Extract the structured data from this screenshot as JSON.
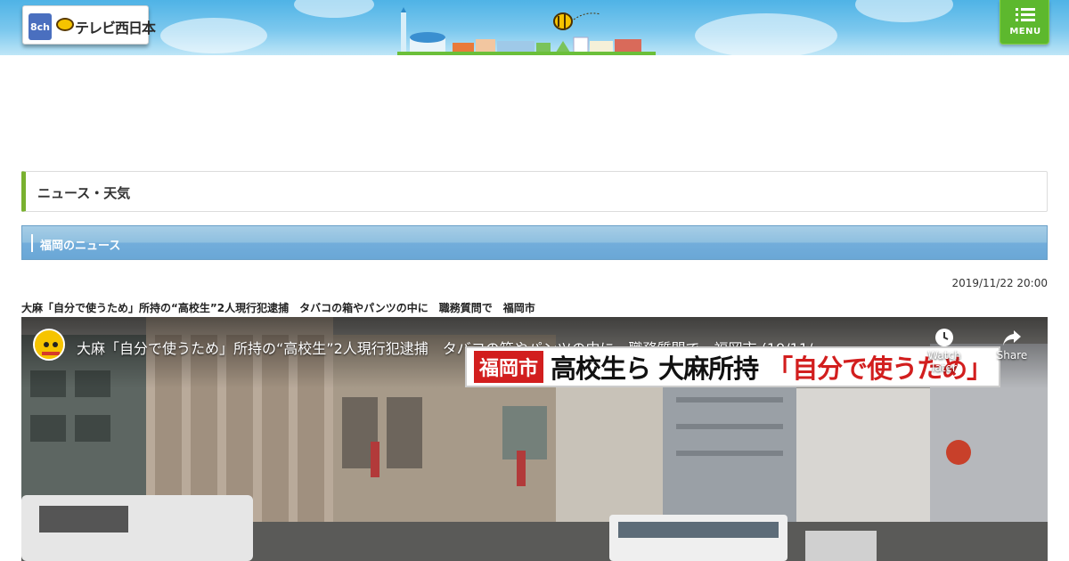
{
  "header": {
    "channel_badge": "8ch",
    "logo_text": "テレビ西日本",
    "menu_label": "MENU",
    "menu_icon": "list-menu-icon"
  },
  "section": {
    "title": "ニュース・天気"
  },
  "region": {
    "title": "福岡のニュース"
  },
  "article": {
    "date": "2019/11/22 20:00",
    "headline": "大麻「自分で使うため」所持の“高校生”2人現行犯逮捕　タバコの箱やパンツの中に　職務質問で　福岡市"
  },
  "video": {
    "title": "大麻「自分で使うため」所持の“高校生”2人現行犯逮捕　タバコの箱やパンツの中に　職務質問で　福岡市 (19/11/...",
    "watch_later_label": "Watch later",
    "share_label": "Share",
    "caption_city": "福岡市",
    "caption_main": "高校生ら 大麻所持",
    "caption_quote": "「自分で使うため」",
    "channel_icon": "channel-avatar-icon"
  },
  "colors": {
    "menu_green": "#5db82e",
    "section_accent": "#79b12f",
    "region_blue": "#6aa7d6",
    "caption_red": "#d21e1e"
  }
}
